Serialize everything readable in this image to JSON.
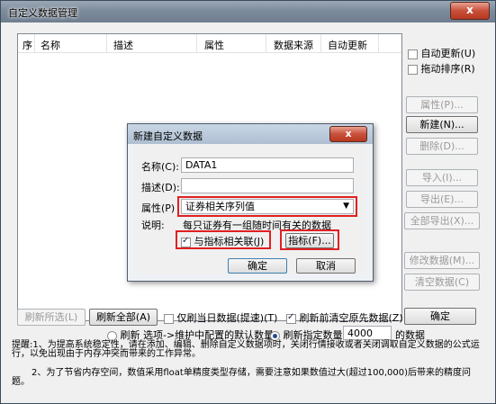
{
  "window": {
    "title": "自定义数据管理",
    "close": "x"
  },
  "table": {
    "headers": [
      "序",
      "名称",
      "描述",
      "属性",
      "数据来源",
      "自动更新"
    ]
  },
  "right_panel": {
    "auto_update": "自动更新(U)",
    "drag_sort": "拖动排序(R)",
    "buttons": {
      "property": "属性(P)...",
      "new": "新建(N)...",
      "delete": "删除(D)...",
      "import": "导入(I)...",
      "export": "导出(E)...",
      "export_all": "全部导出(X)...",
      "modify_data": "修改数据(M)...",
      "clear_data": "清空数据(C)"
    }
  },
  "bottom": {
    "refresh_selected": "刷新所选(L)",
    "refresh_all": "刷新全部(A)",
    "only_today": "仅刷当日数据(提速)(T)",
    "clear_before": "刷新前清空原先数据(Z)",
    "ok": "确定",
    "radio1_label": "刷新 选项->维护中配置的默认数量",
    "radio2_label": "刷新指定数量",
    "count_value": "4000",
    "count_suffix": "的数据",
    "tip1": "提醒:1、为提高系统稳定性，请在添加、编辑、删除自定义数据项时，关闭行情接收或者关闭调取自定义数据的公式运行，以免出现由于内存冲突而带来的工作异常。",
    "tip2": "2、为了节省内存空间，数值采用float单精度类型存储，需要注意如果数值过大(超过100,000)后带来的精度问题。"
  },
  "dialog": {
    "title": "新建自定义数据",
    "close": "x",
    "name_label": "名称(C):",
    "name_value": "DATA1",
    "desc_label": "描述(D):",
    "desc_value": "",
    "attr_label": "属性(P)",
    "attr_value": "证券相关序列值",
    "explain_label": "说明:",
    "explain_text": "每只证券有一组随时间有关的数据",
    "link_label": "与指标相关联(J)",
    "indicator_button": "指标(F)...",
    "ok": "确定",
    "cancel": "取消"
  }
}
